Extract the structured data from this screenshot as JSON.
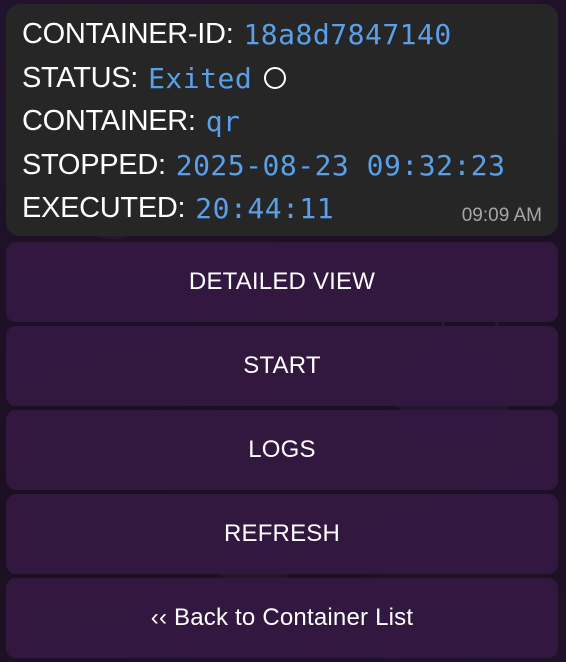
{
  "message": {
    "rows": [
      {
        "label": "CONTAINER-ID:",
        "value": "18a8d7847140"
      },
      {
        "label": "STATUS:",
        "value": "Exited",
        "icon": "circle-outline-icon"
      },
      {
        "label": "CONTAINER:",
        "value": "qr"
      },
      {
        "label": "STOPPED:",
        "value": "2025-08-23 09:32:23"
      },
      {
        "label": "EXECUTED:",
        "value": "20:44:11"
      }
    ],
    "time": "09:09 AM"
  },
  "buttons": {
    "detailed_view": "DETAILED VIEW",
    "start": "START",
    "logs": "LOGS",
    "refresh": "REFRESH",
    "back": "‹‹ Back to Container List"
  },
  "colors": {
    "value_text": "#5aa0e8",
    "message_bg": "#262626",
    "button_bg": "#341942",
    "background": "#1e1126"
  }
}
